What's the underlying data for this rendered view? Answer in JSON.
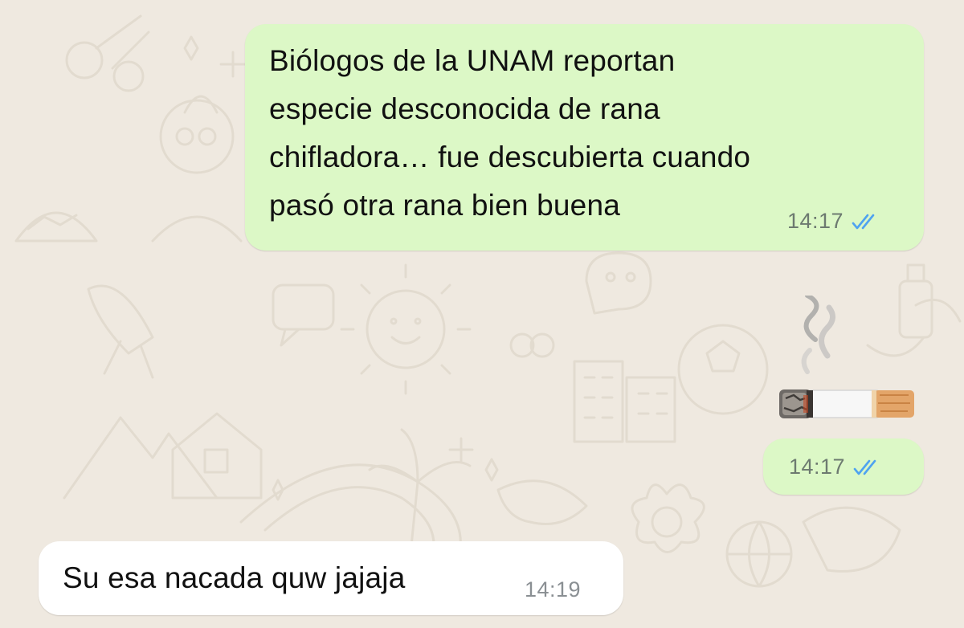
{
  "chat": {
    "messages": [
      {
        "direction": "outgoing",
        "text": "Biólogos de la UNAM reportan\nespecie desconocida de rana\nchifladora… fue descubierta cuando\npasó otra rana bien buena",
        "time": "14:17",
        "status": "read",
        "status_icon": "double-check-icon"
      },
      {
        "direction": "outgoing",
        "emoji": "🚬",
        "emoji_icon": "cigarette-emoji",
        "time": "14:17",
        "status": "read",
        "status_icon": "double-check-icon"
      },
      {
        "direction": "incoming",
        "text": "Su esa nacada quw jajaja",
        "time": "14:19"
      }
    ]
  },
  "colors": {
    "wallpaper": "#efe9e0",
    "outgoing_bubble": "#dcf8c6",
    "incoming_bubble": "#ffffff",
    "read_ticks": "#4fa3f0",
    "timestamp": "#6d7a70"
  }
}
